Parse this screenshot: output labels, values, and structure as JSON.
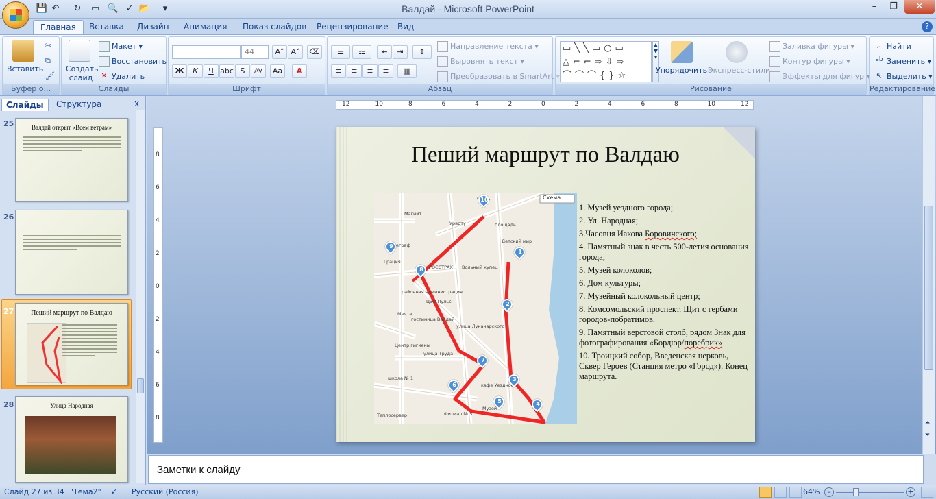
{
  "window": {
    "title": "Валдай - Microsoft PowerPoint"
  },
  "tabs": [
    "Главная",
    "Вставка",
    "Дизайн",
    "Анимация",
    "Показ слайдов",
    "Рецензирование",
    "Вид"
  ],
  "ribbon": {
    "clipboard": {
      "label": "Буфер о...",
      "paste": "Вставить"
    },
    "slides": {
      "label": "Слайды",
      "create": "Создать слайд",
      "layout": "Макет",
      "reset": "Восстановить",
      "delete": "Удалить"
    },
    "font": {
      "label": "Шрифт",
      "size": "44",
      "buttons": [
        "Ж",
        "К",
        "Ч",
        "abc",
        "S",
        "AV",
        "Aa",
        "A"
      ]
    },
    "paragraph": {
      "label": "Абзац",
      "text_direction": "Направление текста",
      "align_text": "Выровнять текст",
      "smartart": "Преобразовать в SmartArt"
    },
    "drawing": {
      "label": "Рисование",
      "arrange": "Упорядочить",
      "quick_styles": "Экспресс-стили",
      "fill": "Заливка фигуры",
      "outline": "Контур фигуры",
      "effects": "Эффекты для фигур"
    },
    "editing": {
      "label": "Редактирование",
      "find": "Найти",
      "replace": "Заменить",
      "select": "Выделить"
    }
  },
  "panel": {
    "tab_slides": "Слайды",
    "tab_outline": "Структура",
    "close": "x",
    "thumbs": [
      {
        "num": "25",
        "title": "Валдай открыт «Всем ветрам»"
      },
      {
        "num": "26",
        "title": ""
      },
      {
        "num": "27",
        "title": "Пеший маршрут по Валдаю"
      },
      {
        "num": "28",
        "title": "Улица Народная"
      }
    ]
  },
  "ruler": {
    "h": [
      "12",
      "10",
      "8",
      "6",
      "4",
      "2",
      "0",
      "2",
      "4",
      "6",
      "8",
      "10",
      "12"
    ],
    "v": [
      "8",
      "6",
      "4",
      "2",
      "0",
      "2",
      "4",
      "6",
      "8"
    ]
  },
  "slide": {
    "title": "Пеший маршрут  по Валдаю",
    "map": {
      "scheme_label": "Схема",
      "labels": [
        "Связь",
        "Магнит",
        "Урарту",
        "площадь",
        "Детский мир",
        "телеграф",
        "Грация",
        "ГОССТРАХ",
        "Вольный купец",
        "районная администрация",
        "ЦЗО Пульс",
        "Мечта",
        "гостиница Валдай",
        "улица Луначарского",
        "Центр гигиены",
        "улица Труда",
        "школа № 1",
        "кафе Уездное",
        "Музей",
        "Теплосервер",
        "Филиал № 5"
      ],
      "pins": [
        "10",
        "9",
        "8",
        "1",
        "2",
        "7",
        "3",
        "6",
        "5",
        "4"
      ]
    },
    "list": [
      "1. Музей уездного города;",
      "2. Ул. Народная;",
      "3.Часовня Иакова ",
      "4. Памятный знак в честь 500-летия основания города;",
      "5. Музей колоколов;",
      "6.   Дом культуры;",
      "7. Музейный колокольный центр;",
      "8. Комсомольский проспект. Щит с гербами городов-побратимов.",
      "9. Памятный верстовой столб, рядом Знак для фотографирования «Бордюр/",
      "10. Троицкий собор, Введенская церковь, Сквер Героев (Станция метро «Город»). Конец маршрута."
    ],
    "list_squig": [
      "Боровичского;",
      "поребрик»"
    ]
  },
  "notes": {
    "placeholder": "Заметки к слайду"
  },
  "status": {
    "slide": "Слайд 27 из 34",
    "theme": "\"Тема2\"",
    "language": "Русский (Россия)",
    "zoom": "64%"
  }
}
